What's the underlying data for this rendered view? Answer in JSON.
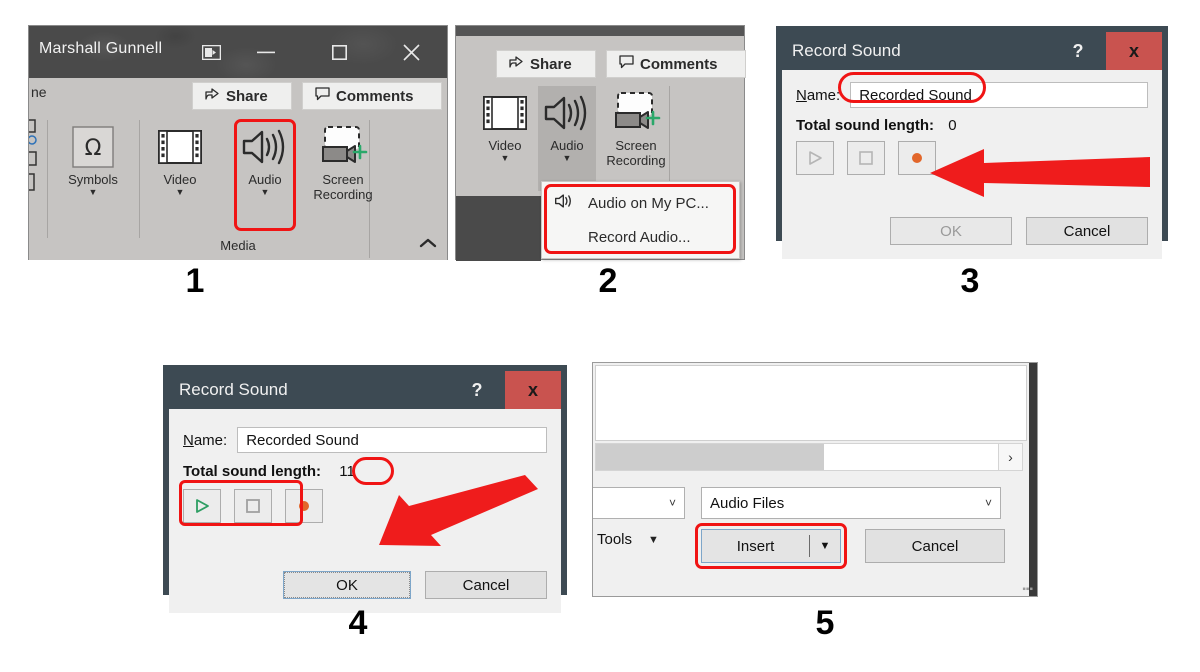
{
  "steps": [
    {
      "number": "1"
    },
    {
      "number": "2"
    },
    {
      "number": "3"
    },
    {
      "number": "4"
    },
    {
      "number": "5"
    }
  ],
  "panel1": {
    "titlebar": {
      "name": "Marshall Gunnell",
      "ribbon_display_icon": "ribbon-display-options-icon",
      "minimize_icon": "minimize-icon",
      "maximize_icon": "maximize-icon",
      "close_icon": "close-icon"
    },
    "tab_fragment": "ne",
    "share_label": "Share",
    "comments_label": "Comments",
    "symbols_label": "Symbols",
    "video_label": "Video",
    "audio_label": "Audio",
    "screen_recording_line1": "Screen",
    "screen_recording_line2": "Recording",
    "group_label": "Media",
    "collapse_icon": "chevron-up-icon"
  },
  "panel2": {
    "share_label": "Share",
    "comments_label": "Comments",
    "video_label": "Video",
    "audio_label": "Audio",
    "screen_recording_line1": "Screen",
    "screen_recording_line2": "Recording",
    "menu_items": [
      {
        "label": "Audio on My PC...",
        "icon": "speaker-icon"
      },
      {
        "label": "Record Audio...",
        "icon": ""
      }
    ]
  },
  "panel3": {
    "title": "Record Sound",
    "help_label": "?",
    "close_label": "x",
    "name_label": "Name:",
    "name_value": "Recorded Sound",
    "length_label": "Total sound length:",
    "length_value": "0",
    "play_icon": "play-icon",
    "stop_icon": "stop-icon",
    "record_icon": "record-icon",
    "ok_label": "OK",
    "cancel_label": "Cancel"
  },
  "panel4": {
    "title": "Record Sound",
    "help_label": "?",
    "close_label": "x",
    "name_label": "Name:",
    "name_value": "Recorded Sound",
    "length_label": "Total sound length:",
    "length_value": "11",
    "play_icon": "play-icon",
    "stop_icon": "stop-icon",
    "record_icon": "record-icon",
    "ok_label": "OK",
    "cancel_label": "Cancel"
  },
  "panel5": {
    "scroll_right_icon": "chevron-right-icon",
    "filetype_value": "Audio Files",
    "tools_label": "Tools",
    "insert_label": "Insert",
    "cancel_label": "Cancel",
    "tools_caret": "caret-down-icon",
    "insert_caret": "caret-down-icon"
  },
  "colors": {
    "highlight_red": "#f01414",
    "arrow_red": "#ef1c1c",
    "dialog_titlebar": "#3d4a53",
    "dialog_close": "#c9534f",
    "ribbon_bg": "#c6c4c2",
    "record_dot": "#e2662a",
    "play_green": "#2e9e63"
  }
}
